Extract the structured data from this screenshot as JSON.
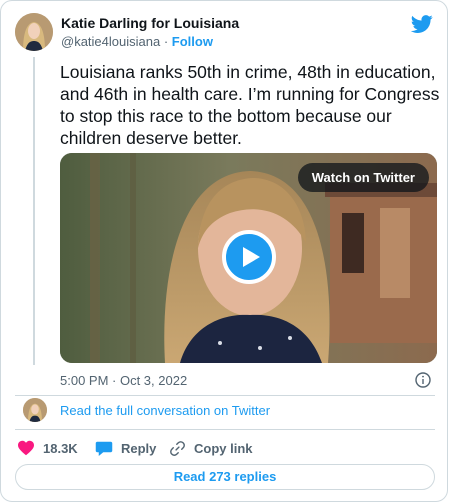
{
  "author": {
    "name": "Katie Darling for Louisiana",
    "handle": "@katie4louisiana",
    "separator": "·",
    "follow_label": "Follow"
  },
  "tweet": {
    "text": "Louisiana ranks 50th in crime, 48th in education, and 46th in health care. I’m running for Congress to stop this race to the bottom because our children deserve better.",
    "timestamp": "5:00 PM · Oct 3, 2022"
  },
  "media": {
    "watch_label": "Watch on Twitter"
  },
  "conversation": {
    "link_label": "Read the full conversation on Twitter"
  },
  "actions": {
    "like_count": "18.3K",
    "reply_label": "Reply",
    "copy_link_label": "Copy link"
  },
  "footer": {
    "read_replies_label": "Read 273 replies"
  },
  "colors": {
    "accent": "#1d9bf0",
    "like": "#f91880",
    "text": "#0f1419",
    "muted": "#536471",
    "border": "#cfd9de"
  }
}
